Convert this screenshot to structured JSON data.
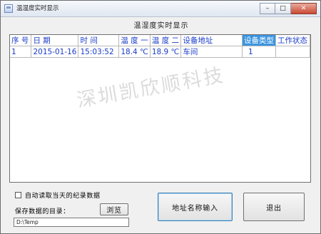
{
  "window": {
    "title": "温湿度实时显示"
  },
  "caption_buttons": {
    "minimize": "–",
    "maximize": "□",
    "close": "✕"
  },
  "heading": "温湿度实时显示",
  "watermark": "深圳凯欣顺科技",
  "table": {
    "columns": [
      "序 号",
      "日 期",
      "时 间",
      "温 度 一",
      "温 度 二",
      "设备地址",
      "设备类型",
      "工作状态"
    ],
    "selected_column": "设备类型",
    "rows": [
      [
        "1",
        "2015-01-16",
        "15:03:52",
        "18.4 ℃",
        "18.9 ℃",
        "车间",
        "1",
        ""
      ]
    ]
  },
  "auto_read": {
    "label": "自动读取当天的纪录数据",
    "checked": false
  },
  "save_dir": {
    "label": "保存数据的目录：",
    "browse_label": "浏览",
    "path": "D:\\Temp"
  },
  "buttons": {
    "address_input": "地址名称输入",
    "exit": "退出"
  }
}
